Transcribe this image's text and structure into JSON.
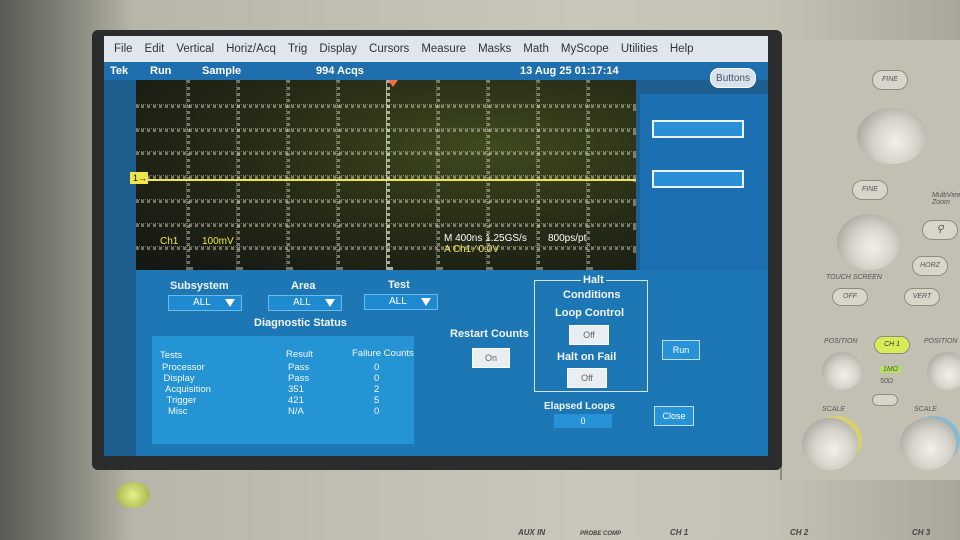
{
  "menu": [
    "File",
    "Edit",
    "Vertical",
    "Horiz/Acq",
    "Trig",
    "Display",
    "Cursors",
    "Measure",
    "Masks",
    "Math",
    "MyScope",
    "Utilities",
    "Help"
  ],
  "status": {
    "brand": "Tek",
    "run_state": "Run",
    "mode": "Sample",
    "acqs": "994 Acqs",
    "datetime": "13 Aug 25 01:17:14",
    "buttons_label": "Buttons"
  },
  "waveform": {
    "channel_marker": "1",
    "ch_label": "Ch1",
    "scale": "100mV",
    "timebase": "M 400ns 1.25GS/s",
    "resolution": "800ps/pt",
    "trigger": "A  Ch1  ⁄  0.0V"
  },
  "diagnostics": {
    "subsystem_label": "Subsystem",
    "subsystem_value": "ALL",
    "area_label": "Area",
    "area_value": "ALL",
    "test_label": "Test",
    "test_value": "ALL",
    "status_title": "Diagnostic Status",
    "columns": [
      "Tests",
      "Result",
      "Failure Counts"
    ],
    "rows": [
      {
        "test": "Processor",
        "result": "Pass",
        "failures": "0"
      },
      {
        "test": "Display",
        "result": "Pass",
        "failures": "0"
      },
      {
        "test": "Acquisition",
        "result": "351",
        "failures": "2"
      },
      {
        "test": "Trigger",
        "result": "421",
        "failures": "5"
      },
      {
        "test": "Misc",
        "result": "N/A",
        "failures": "0"
      }
    ],
    "restart_counts_label": "Restart Counts",
    "restart_counts_value": "On",
    "halt_title_1": "Halt",
    "halt_title_2": "Conditions",
    "loop_control_label": "Loop Control",
    "loop_control_value": "Off",
    "halt_on_fail_label": "Halt on Fail",
    "halt_on_fail_value": "Off",
    "run_label": "Run",
    "elapsed_loops_label": "Elapsed Loops",
    "elapsed_loops_value": "0",
    "close_label": "Close"
  },
  "front_panel": {
    "fine": "FINE",
    "touch_screen": "TOUCH SCREEN",
    "off": "OFF",
    "multiview": "MultiView Zoom",
    "horz": "HORZ",
    "vert": "VERT",
    "position": "POSITION",
    "scale": "SCALE",
    "ch1": "CH 1",
    "ch1_imp": "1MΩ",
    "ch1_sub": "50Ω"
  },
  "bottom_labels": {
    "aux_in": "AUX IN",
    "probe_comp": "PROBE COMP",
    "ch1": "CH 1",
    "ch2": "CH 2",
    "ch3": "CH 3"
  }
}
